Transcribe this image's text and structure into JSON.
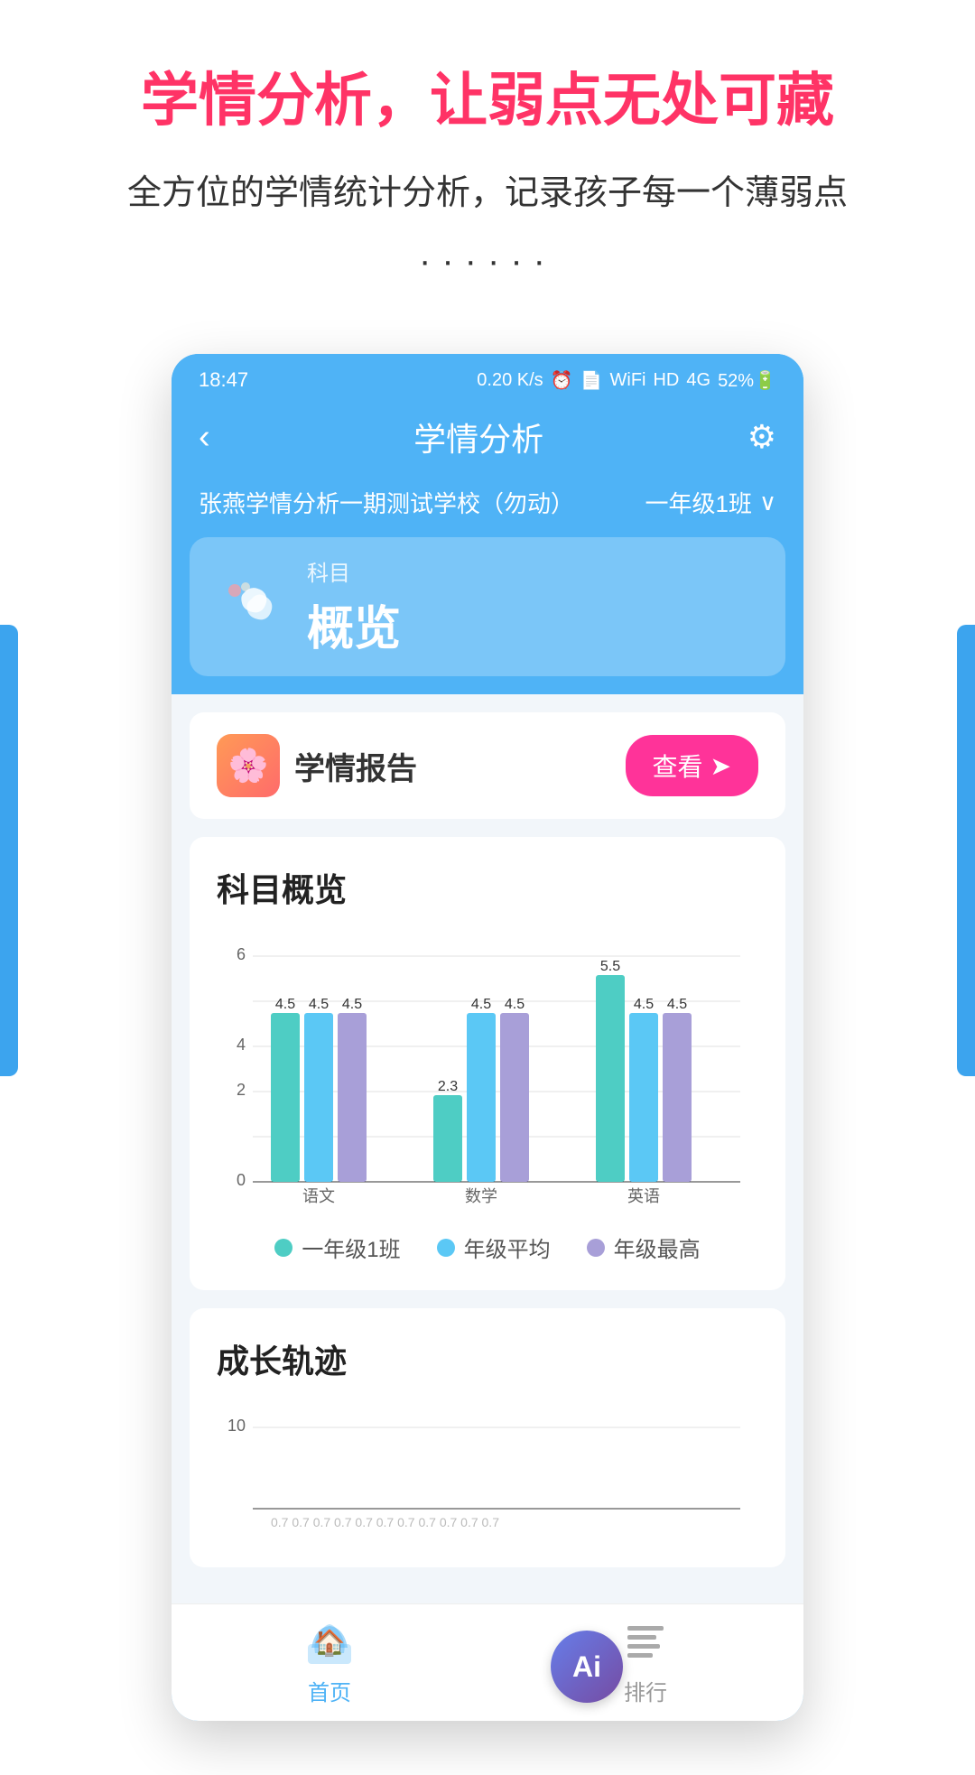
{
  "promo": {
    "title": "学情分析，让弱点无处可藏",
    "subtitle": "全方位的学情统计分析，记录孩子每一个薄弱点",
    "dots": "······"
  },
  "statusBar": {
    "time": "18:47",
    "icons": "0.20 K/s  ⏰  📶  HD  4G  HD  52%"
  },
  "navBar": {
    "back": "‹",
    "title": "学情分析",
    "gear": "⚙"
  },
  "schoolRow": {
    "school": "张燕学情分析一期测试学校（勿动）",
    "class": "一年级1班",
    "arrow": "∨"
  },
  "subjectTab": {
    "label_small": "科目",
    "label_big": "概览"
  },
  "reportCard": {
    "title": "学情报告",
    "viewBtn": "查看",
    "viewArrow": "➤"
  },
  "chartSection": {
    "title": "科目概览",
    "yMax": 6,
    "yLabels": [
      "0",
      "2",
      "4",
      "6"
    ],
    "subjects": [
      {
        "name": "语文",
        "bars": [
          {
            "value": 4.5,
            "label": "4.5",
            "color": "#4ecdc4"
          },
          {
            "value": 4.5,
            "label": "4.5",
            "color": "#5bc8f5"
          },
          {
            "value": 4.5,
            "label": "4.5",
            "color": "#a89fd8"
          }
        ]
      },
      {
        "name": "数学",
        "bars": [
          {
            "value": 2.3,
            "label": "2.3",
            "color": "#4ecdc4"
          },
          {
            "value": 4.5,
            "label": "4.5",
            "color": "#5bc8f5"
          },
          {
            "value": 4.5,
            "label": "4.5",
            "color": "#a89fd8"
          }
        ]
      },
      {
        "name": "英语",
        "bars": [
          {
            "value": 5.5,
            "label": "5.5",
            "color": "#4ecdc4"
          },
          {
            "value": 4.5,
            "label": "4.5",
            "color": "#5bc8f5"
          },
          {
            "value": 4.5,
            "label": "4.5",
            "color": "#a89fd8"
          }
        ]
      }
    ],
    "legend": [
      {
        "label": "一年级1班",
        "color": "#4ecdc4"
      },
      {
        "label": "年级平均",
        "color": "#5bc8f5"
      },
      {
        "label": "年级最高",
        "color": "#a89fd8"
      }
    ]
  },
  "growthSection": {
    "title": "成长轨迹",
    "yMax": 10
  },
  "bottomNav": {
    "home": {
      "label": "首页",
      "active": true
    },
    "rank": {
      "label": "排行",
      "active": false
    }
  },
  "aiBadge": "Ai"
}
